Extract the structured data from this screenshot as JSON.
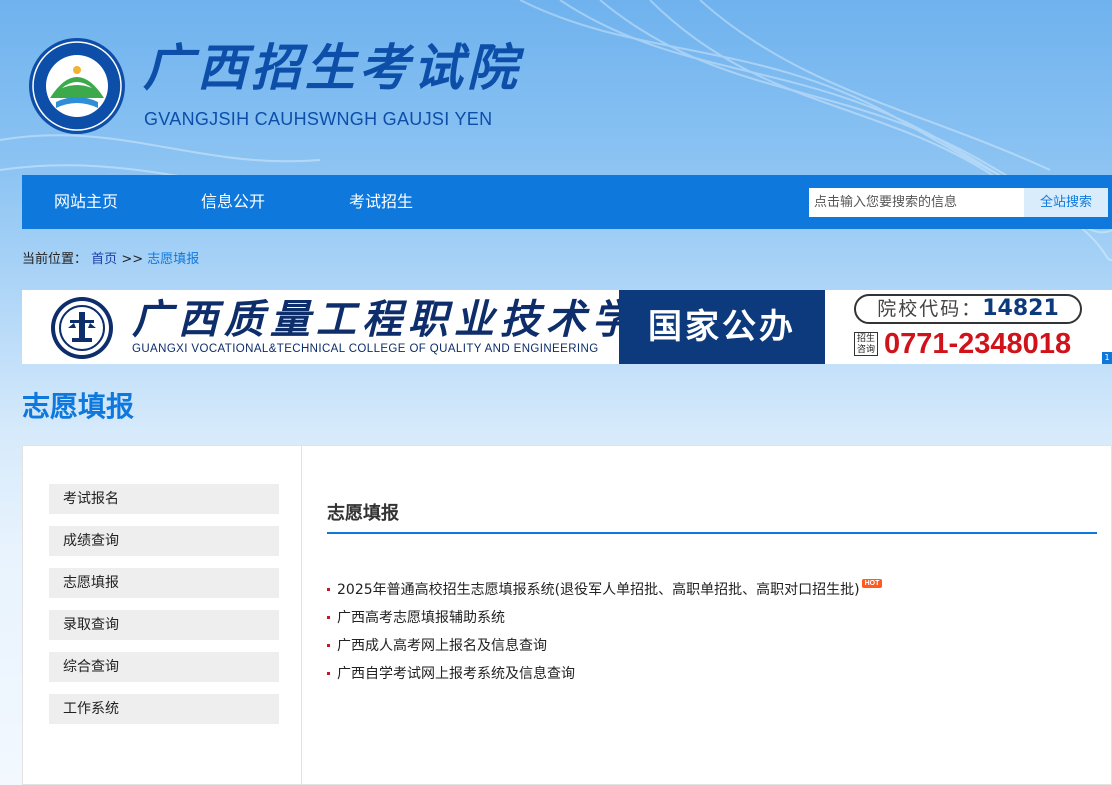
{
  "header": {
    "title": "广西招生考试院",
    "subtitle": "GVANGJSIH CAUHSWNGH GAUJSI YEN",
    "logo_ring_text": "GVANGJSIH CAUHSWNGH GAUJSI YEN"
  },
  "nav": {
    "items": [
      {
        "label": "网站主页"
      },
      {
        "label": "信息公开"
      },
      {
        "label": "考试招生"
      }
    ],
    "search_placeholder": "点击输入您要搜索的信息",
    "search_button": "全站搜索"
  },
  "breadcrumb": {
    "prefix": "当前位置：",
    "home": "首页",
    "separator": ">>",
    "current": "志愿填报"
  },
  "banner": {
    "name_cn": "广西质量工程职业技术学院",
    "name_en": "GUANGXI VOCATIONAL&TECHNICAL COLLEGE OF QUALITY AND ENGINEERING",
    "tag": "国家公办",
    "code_label": "院校代码：",
    "code": "14821",
    "consult_label": "招生咨询",
    "phone": "0771-2348018",
    "corner_mark": "1"
  },
  "page_heading": "志愿填报",
  "sidebar": {
    "items": [
      {
        "label": "考试报名"
      },
      {
        "label": "成绩查询"
      },
      {
        "label": "志愿填报"
      },
      {
        "label": "录取查询"
      },
      {
        "label": "综合查询"
      },
      {
        "label": "工作系统"
      }
    ]
  },
  "main": {
    "title": "志愿填报",
    "links": [
      {
        "text": "2025年普通高校招生志愿填报系统(退役军人单招批、高职单招批、高职对口招生批)",
        "badge": "HOT"
      },
      {
        "text": "广西高考志愿填报辅助系统"
      },
      {
        "text": "广西成人高考网上报名及信息查询"
      },
      {
        "text": "广西自学考试网上报考系统及信息查询"
      }
    ]
  },
  "colors": {
    "primary": "#0f78dc",
    "title_blue": "#0d4ea8",
    "phone_red": "#d0121b",
    "hot_orange": "#ff5a1f"
  }
}
